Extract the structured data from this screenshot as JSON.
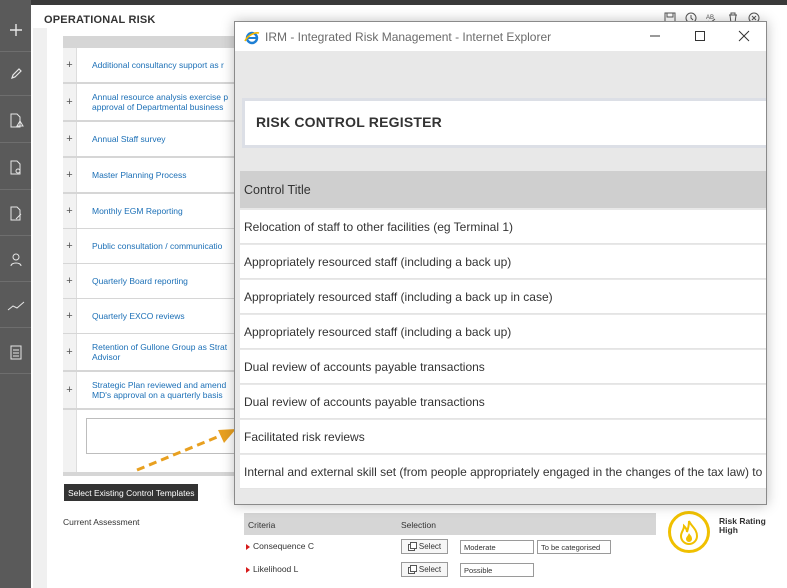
{
  "app": {
    "section_title": "OPERATIONAL RISK"
  },
  "list": {
    "items": [
      "Additional consultancy support as r",
      "Annual resource analysis exercise p\napproval of Departmental business",
      "Annual Staff survey",
      "Master Planning Process",
      "Monthly EGM Reporting",
      "Public consultation / communicatio",
      "Quarterly Board reporting",
      "Quarterly EXCO reviews",
      "Retention of Gullone Group as Strat\nAdvisor",
      "Strategic Plan reviewed and amend\nMD's approval on a quarterly basis"
    ],
    "expand_symbol": "+"
  },
  "templates_button": "Select Existing Control Templates",
  "assessment": {
    "label": "Current Assessment",
    "criteria_header": "Criteria",
    "selection_header": "Selection",
    "rows": [
      {
        "name": "Consequence C",
        "select": "Select",
        "value": "Moderate",
        "extra": "To be categorised"
      },
      {
        "name": "Likelihood L",
        "select": "Select",
        "value": "Possible",
        "extra": ""
      }
    ]
  },
  "risk_rating": {
    "line1": "Risk Rating",
    "line2": "High",
    "color": "#f0c000"
  },
  "popup": {
    "window_title": "IRM - Integrated Risk Management - Internet Explorer",
    "register_title": "RISK CONTROL REGISTER",
    "column_header": "Control Title",
    "controls": [
      "Relocation of staff to other facilities (eg Terminal 1)",
      "Appropriately resourced staff (including a back up)",
      "Appropriately resourced staff (including a back up in case)",
      "Appropriately resourced staff (including a back up)",
      "Dual review of accounts payable transactions",
      "Dual review of accounts payable transactions",
      "Facilitated risk reviews",
      "Internal and external skill set (from people appropriately engaged in the changes of the tax law) to"
    ]
  },
  "icons": {
    "left_sidebar": [
      "add-icon",
      "edit-icon",
      "document-warning-icon",
      "document-search-icon",
      "document-edit-icon",
      "people-icon",
      "trend-icon",
      "clipboard-icon"
    ],
    "title_bar": [
      "ie-logo-icon",
      "minimize-icon",
      "maximize-icon",
      "close-icon"
    ],
    "toolbar": [
      "save-icon",
      "clock-icon",
      "spellcheck-icon",
      "delete-icon",
      "close-circle-icon"
    ]
  },
  "colors": {
    "link": "#1b6fb6",
    "arrow": "#e8a020",
    "required_marker": "#d61b1b"
  }
}
